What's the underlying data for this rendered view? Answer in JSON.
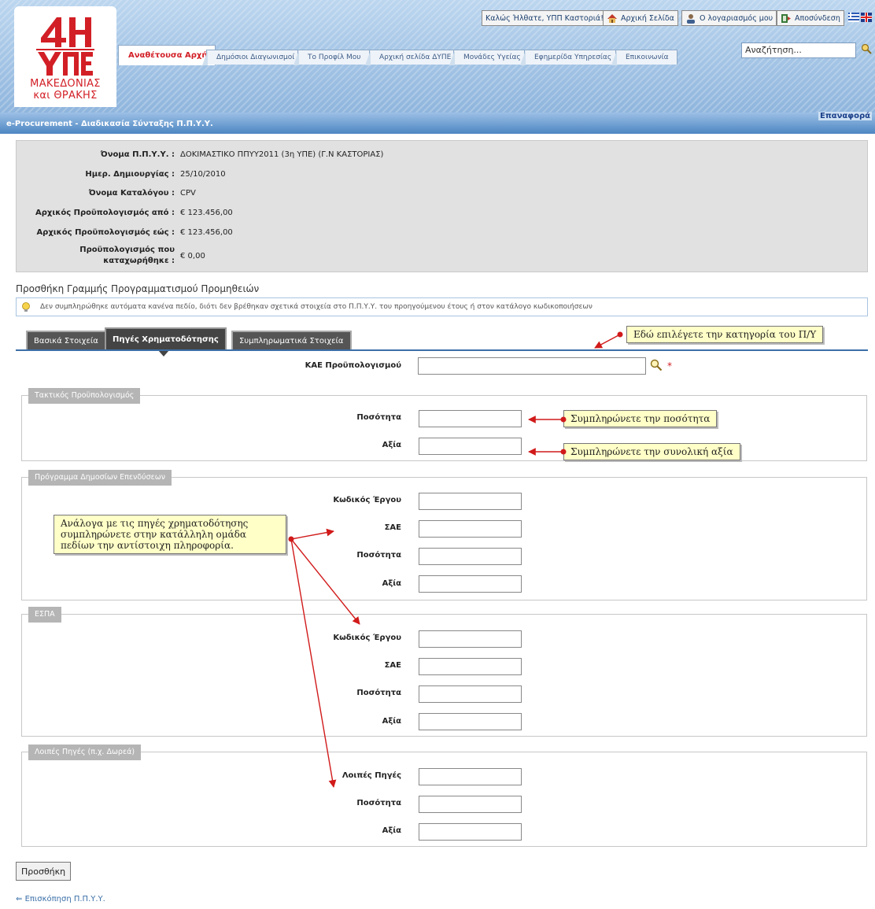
{
  "header": {
    "logo": {
      "line1": "ΜΑΚΕΔΟΝΙΑΣ",
      "line2": "και ΘΡΑΚΗΣ",
      "brand_color": "#d21f26"
    },
    "top_links": {
      "welcome": "Καλώς Ήλθατε, ΥΠΠ Καστοριά!",
      "home": "Αρχική Σελίδα",
      "account": "Ο λογαριασμός μου",
      "logout": "Αποσύνδεση"
    },
    "search": {
      "value": "Αναζήτηση..."
    },
    "nav_tabs": [
      "Αναθέτουσα Αρχή",
      "Δημόσιοι Διαγωνισμοί",
      "Το Προφίλ Μου",
      "Αρχική σελίδα ΔΥΠΕ",
      "Μονάδες Υγείας",
      "Εφημερίδα Υπηρεσίας",
      "Επικοινωνία"
    ],
    "active_nav_index": 0
  },
  "titlebar": {
    "title": "e-Procurement - Διαδικασία Σύνταξης Π.Π.Υ.Υ.",
    "right_link": "Επαναφορά"
  },
  "info": {
    "rows": [
      {
        "label": "Όνομα Π.Π.Υ.Υ. :",
        "value": "ΔΟΚΙΜΑΣΤΙΚΟ ΠΠΥΥ2011 (3η ΥΠΕ) (Γ.Ν ΚΑΣΤΟΡΙΑΣ)"
      },
      {
        "label": "Ημερ. Δημιουργίας :",
        "value": "25/10/2010"
      },
      {
        "label": "Όνομα Καταλόγου :",
        "value": "CPV"
      },
      {
        "label": "Αρχικός Προϋπολογισμός από :",
        "value": "€ 123.456,00"
      },
      {
        "label": "Αρχικός Προϋπολογισμός εώς :",
        "value": "€ 123.456,00"
      }
    ],
    "registered": {
      "label1": "Προϋπολογισμός που",
      "label2": "καταχωρήθηκε :",
      "value": "€ 0,00"
    }
  },
  "section": {
    "title": "Προσθήκη Γραμμής Προγραμματισμού Προμηθειών",
    "hint": "Δεν συμπληρώθηκε αυτόματα κανένα πεδίο, διότι δεν βρέθηκαν σχετικά στοιχεία στο Π.Π.Υ.Υ. του προηγούμενου έτους ή στον κατάλογο κωδικοποιήσεων"
  },
  "form_tabs": {
    "basic": "Βασικά Στοιχεία",
    "funding": "Πηγές Χρηματοδότησης",
    "extra": "Συμπληρωματικά Στοιχεία",
    "active": "funding"
  },
  "form": {
    "kae": {
      "label": "ΚΑΕ Προϋπολογισμού",
      "value": "",
      "required_mark": "*"
    },
    "regular_budget": {
      "legend": "Τακτικός Προϋπολογισμός",
      "quantity": {
        "label": "Ποσότητα",
        "value": ""
      },
      "amount": {
        "label": "Αξία",
        "value": ""
      }
    },
    "public_investment": {
      "legend": "Πρόγραμμα Δημοσίων Επενδύσεων",
      "project_code": {
        "label": "Κωδικός Έργου",
        "value": ""
      },
      "sae": {
        "label": "ΣΑΕ",
        "value": ""
      },
      "quantity": {
        "label": "Ποσότητα",
        "value": ""
      },
      "amount": {
        "label": "Αξία",
        "value": ""
      }
    },
    "espa": {
      "legend": "ΕΣΠΑ",
      "project_code": {
        "label": "Κωδικός Έργου",
        "value": ""
      },
      "sae": {
        "label": "ΣΑΕ",
        "value": ""
      },
      "quantity": {
        "label": "Ποσότητα",
        "value": ""
      },
      "amount": {
        "label": "Αξία",
        "value": ""
      }
    },
    "other_sources": {
      "legend": "Λοιπές Πηγές (π.χ. Δωρεά)",
      "other": {
        "label": "Λοιπές Πηγές",
        "value": ""
      },
      "quantity": {
        "label": "Ποσότητα",
        "value": ""
      },
      "amount": {
        "label": "Αξία",
        "value": ""
      }
    }
  },
  "callouts": {
    "category": "Εδώ επιλέγετε την κατηγορία του Π/Υ",
    "quantity": "Συμπληρώνετε την ποσότητα",
    "amount": "Συμπληρώνετε την συνολική αξία",
    "sources": "Ανάλογα με τις πηγές χρηματοδότησης συμπληρώνετε στην κατάλληλη ομάδα πεδίων την αντίστοιχη πληροφορία."
  },
  "actions": {
    "add_button": "Προσθήκη",
    "back_link": "Επισκόπηση Π.Π.Υ.Υ."
  },
  "colors": {
    "accent": "#3b6fa8",
    "callout_bg": "#ffffc8",
    "arrow": "#d11a1a"
  }
}
